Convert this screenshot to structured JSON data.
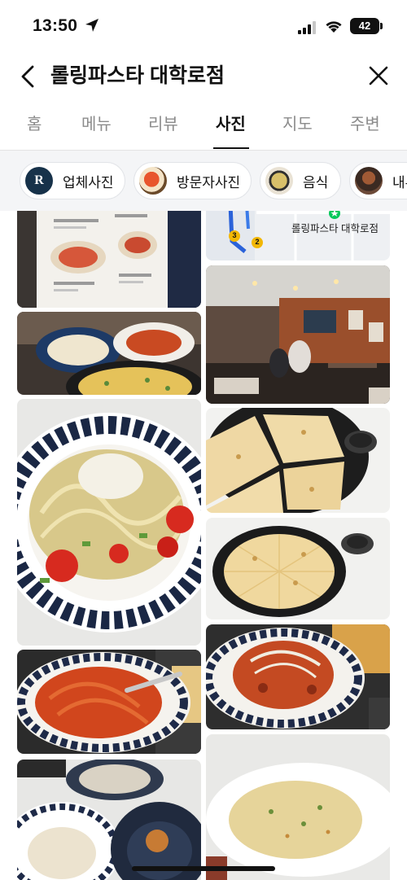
{
  "status_bar": {
    "time": "13:50",
    "battery": "42",
    "icons": [
      "location-arrow-icon",
      "cellular-signal-icon",
      "wifi-icon",
      "battery-icon"
    ]
  },
  "header": {
    "title": "롤링파스타 대학로점",
    "back_icon": "chevron-left-icon",
    "close_icon": "close-icon"
  },
  "tabs": [
    {
      "label": "홈"
    },
    {
      "label": "메뉴"
    },
    {
      "label": "리뷰"
    },
    {
      "label": "사진"
    },
    {
      "label": "지도"
    },
    {
      "label": "주변"
    }
  ],
  "active_tab": "사진",
  "chips": [
    {
      "label": "업체사진"
    },
    {
      "label": "방문자사진"
    },
    {
      "label": "음식"
    },
    {
      "label": "내부"
    }
  ],
  "map_photo": {
    "place_label": "롤링파스타 대학로점",
    "station_badges": [
      "3",
      "2"
    ]
  },
  "menu_photo_letter": "R",
  "colors": {
    "accent_green": "#03c75a",
    "tab_inactive": "#8c8c8c",
    "chip_bg": "#f4f5f7"
  }
}
